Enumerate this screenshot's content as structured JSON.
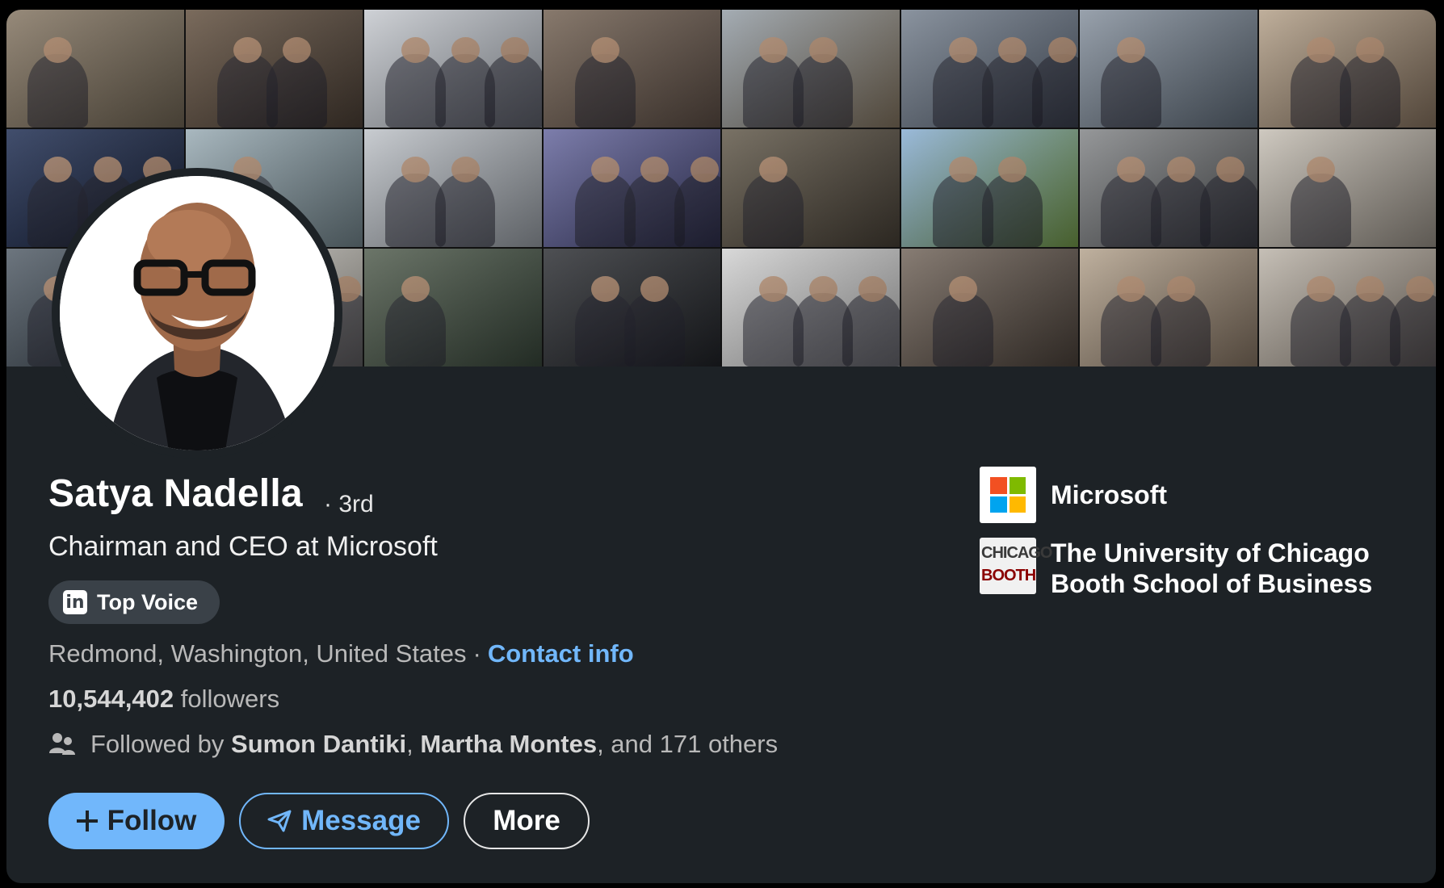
{
  "profile": {
    "name": "Satya Nadella",
    "degree": "· 3rd",
    "headline": "Chairman and CEO at Microsoft",
    "badge": "Top Voice",
    "badge_icon": "linkedin-icon",
    "location": "Redmond, Washington, United States",
    "separator": "·",
    "contact_info": "Contact info",
    "followers_count": "10,544,402",
    "followers_label": "followers",
    "followed_by_prefix": "Followed by",
    "followed_by_names": [
      "Sumon Dantiki",
      "Martha Montes"
    ],
    "followed_by_comma": ",",
    "followed_by_suffix": ", and 171 others"
  },
  "actions": {
    "follow": "Follow",
    "message": "Message",
    "more": "More"
  },
  "companies": [
    {
      "name": "Microsoft",
      "logo": "microsoft-logo"
    },
    {
      "name": "The University of Chicago Booth School of Business",
      "logo": "chicago-booth-logo",
      "logo_text_1": "CHICAGO",
      "logo_text_2": "BOOTH"
    }
  ],
  "colors": {
    "card_background": "#1d2226",
    "accent_blue": "#71b7fb",
    "microsoft_red": "#f25022",
    "microsoft_green": "#7fba00",
    "microsoft_blue": "#00a4ef",
    "microsoft_yellow": "#ffb900"
  },
  "banner": {
    "tiles": [
      {
        "c1": "#8b7d6b",
        "c2": "#5d5446"
      },
      {
        "c1": "#6b5a4a",
        "c2": "#3e342c"
      },
      {
        "c1": "#c9ccd1",
        "c2": "#8a8f96"
      },
      {
        "c1": "#7a6a5c",
        "c2": "#4c4039"
      },
      {
        "c1": "#9aa3ab",
        "c2": "#6b5f4e"
      },
      {
        "c1": "#7d8794",
        "c2": "#4a5360"
      },
      {
        "c1": "#8d97a3",
        "c2": "#4e5863"
      },
      {
        "c1": "#b8a690",
        "c2": "#6e5e4e"
      },
      {
        "c1": "#2c3a5c",
        "c2": "#121a2e"
      },
      {
        "c1": "#9fb0b8",
        "c2": "#5e6d73"
      },
      {
        "c1": "#c2c6cb",
        "c2": "#7d8288"
      },
      {
        "c1": "#6e6fa2",
        "c2": "#34355c"
      },
      {
        "c1": "#6a6254",
        "c2": "#3a342c"
      },
      {
        "c1": "#8fb2d6",
        "c2": "#5f7f3c"
      },
      {
        "c1": "#8a8c8e",
        "c2": "#4a4c4e"
      },
      {
        "c1": "#c9c3b9",
        "c2": "#7d776f"
      },
      {
        "c1": "#5c6670",
        "c2": "#2f3840"
      },
      {
        "c1": "#cfcdc8",
        "c2": "#8a8780"
      },
      {
        "c1": "#5b6658",
        "c2": "#2e3a30"
      },
      {
        "c1": "#3a3c40",
        "c2": "#1a1c20"
      },
      {
        "c1": "#d4d4d4",
        "c2": "#9a9a9a"
      },
      {
        "c1": "#7a6e64",
        "c2": "#3e3630"
      },
      {
        "c1": "#b8a894",
        "c2": "#6d5f51"
      },
      {
        "c1": "#bfb8ae",
        "c2": "#7a7167"
      }
    ]
  }
}
